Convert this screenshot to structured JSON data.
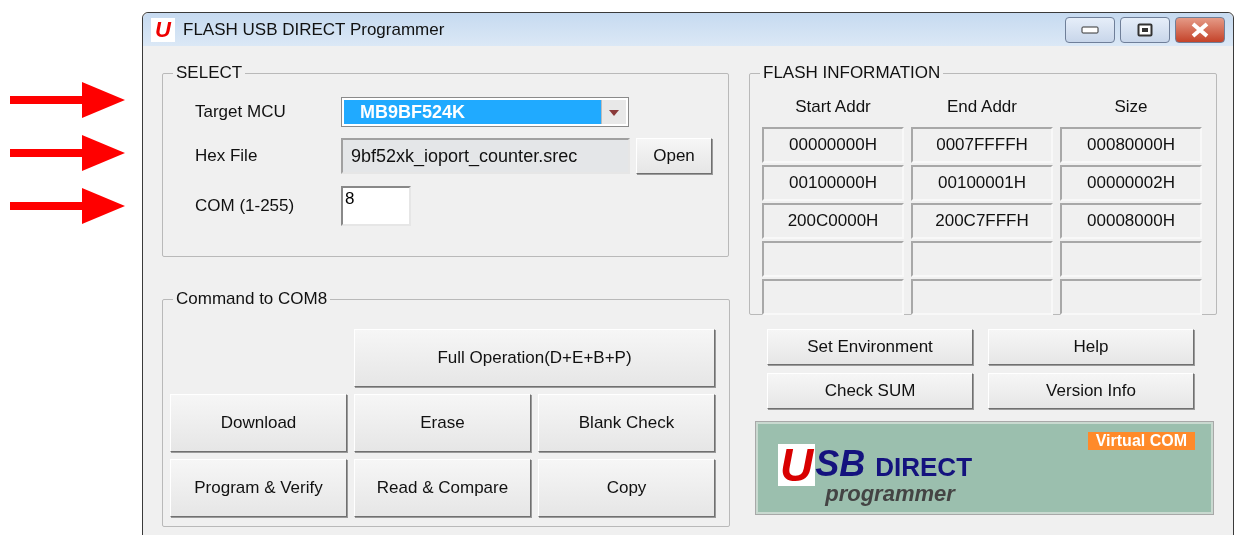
{
  "annotations": [
    {
      "kind": "arrow"
    },
    {
      "kind": "arrow"
    },
    {
      "kind": "arrow"
    }
  ],
  "window": {
    "title": "FLASH USB DIRECT Programmer",
    "app_icon_letter": "U"
  },
  "select": {
    "legend": "SELECT",
    "target_mcu": {
      "label": "Target MCU",
      "value": "MB9BF524K",
      "highlighted": true
    },
    "hex_file": {
      "label": "Hex File",
      "value": "9bf52xk_ioport_counter.srec",
      "button": "Open"
    },
    "com": {
      "label": "COM (1-255)",
      "value": "8"
    }
  },
  "command": {
    "legend": "Command  to  COM8",
    "buttons": [
      {
        "label": "Full Operation(D+E+B+P)",
        "kind": "wide"
      },
      {
        "label": "Download",
        "kind": "normal"
      },
      {
        "label": "Erase",
        "kind": "normal"
      },
      {
        "label": "Blank Check",
        "kind": "normal"
      },
      {
        "label": "Program & Verify",
        "kind": "normal"
      },
      {
        "label": "Read & Compare",
        "kind": "normal"
      },
      {
        "label": "Copy",
        "kind": "normal"
      }
    ]
  },
  "flash_information": {
    "legend": "FLASH INFORMATION",
    "columns": [
      "Start Addr",
      "End Addr",
      "Size"
    ],
    "rows": [
      [
        "00000000H",
        "0007FFFFH",
        "00080000H"
      ],
      [
        "00100000H",
        "00100001H",
        "00000002H"
      ],
      [
        "200C0000H",
        "200C7FFFH",
        "00008000H"
      ]
    ]
  },
  "tool_buttons": [
    "Set Environment",
    "Help",
    "Check SUM",
    "Version Info"
  ],
  "logo": {
    "u": "U",
    "sb": "SB",
    "direct": "DIRECT",
    "sub": "programmer",
    "badge": "Virtual COM"
  }
}
